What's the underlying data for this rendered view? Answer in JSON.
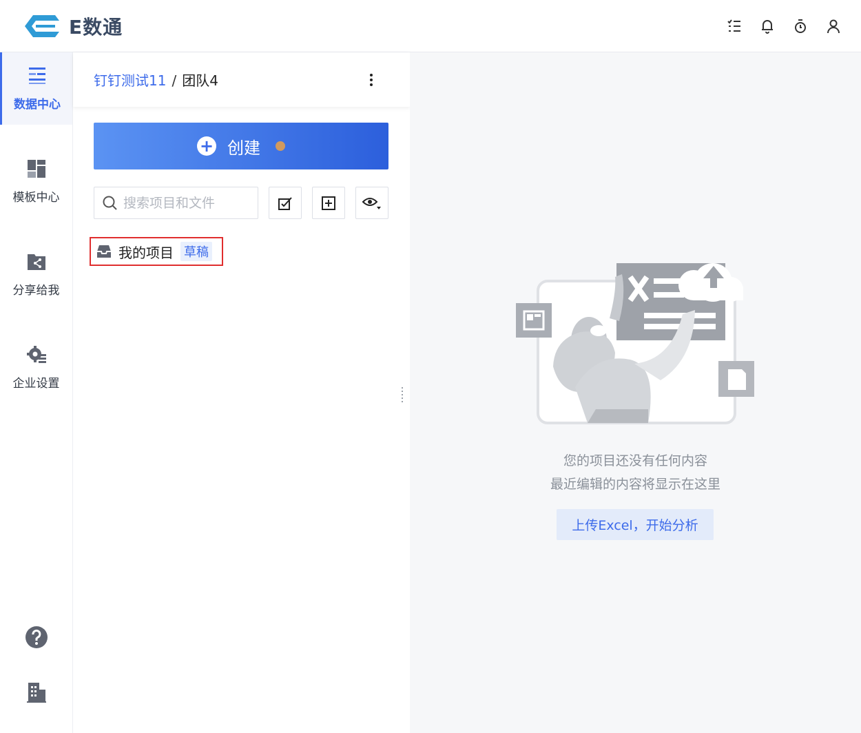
{
  "app": {
    "logo_text": "E数通"
  },
  "header": {
    "icons": [
      "task-list-icon",
      "bell-icon",
      "timer-icon",
      "user-icon"
    ]
  },
  "sidenav": {
    "items": [
      {
        "label": "数据中心",
        "icon": "data-center-icon",
        "active": true
      },
      {
        "label": "模板中心",
        "icon": "template-icon",
        "active": false
      },
      {
        "label": "分享给我",
        "icon": "share-folder-icon",
        "active": false
      },
      {
        "label": "企业设置",
        "icon": "gear-icon",
        "active": false
      }
    ],
    "bottom_icons": [
      "help-icon",
      "building-icon"
    ]
  },
  "panel": {
    "breadcrumb": {
      "parent": "钉钉测试11",
      "separator": "/",
      "current": "团队4"
    },
    "create_label": "创建",
    "search_placeholder": "搜索项目和文件",
    "tree": [
      {
        "name": "我的项目",
        "tag": "草稿",
        "icon": "inbox-icon"
      }
    ]
  },
  "main": {
    "empty_line1": "您的项目还没有任何内容",
    "empty_line2": "最近编辑的内容将显示在这里",
    "upload_label": "上传Excel，开始分析"
  },
  "colors": {
    "accent": "#3d6bea",
    "highlight_border": "#e02e2e",
    "create_dot": "#d19a5e"
  }
}
